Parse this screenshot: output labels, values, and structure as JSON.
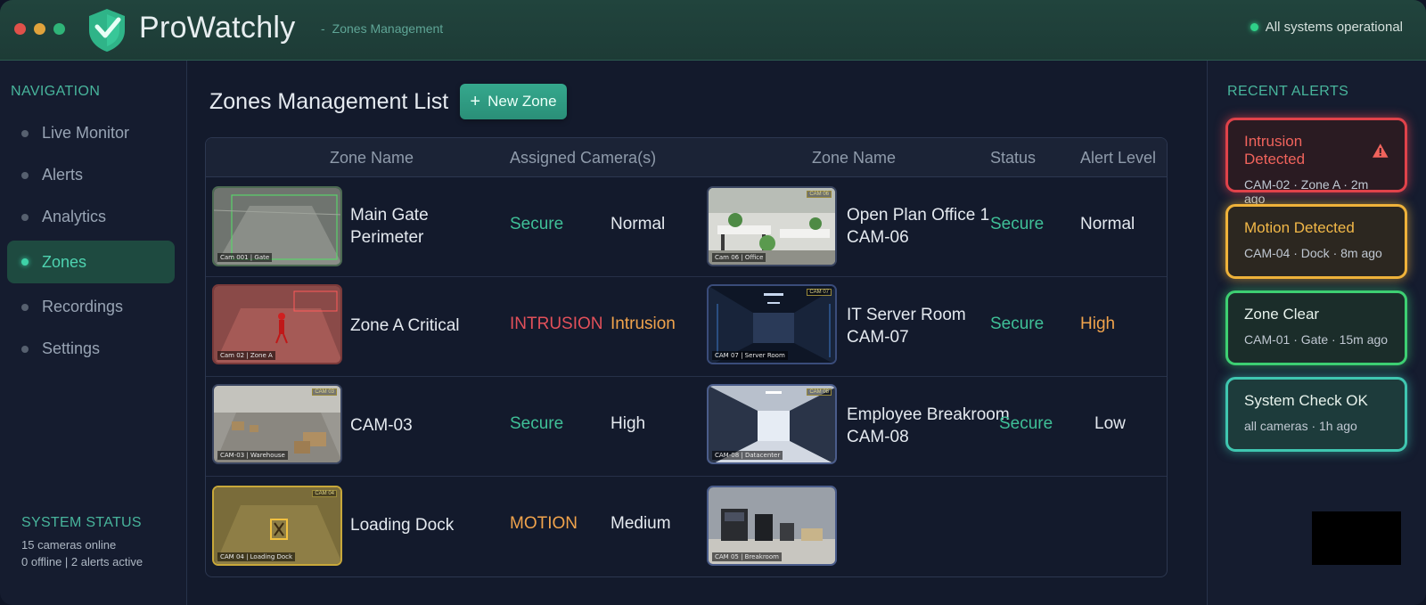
{
  "window": {
    "app_name": "ProWatchly",
    "breadcrumb_sep": "-",
    "breadcrumb": "Zones Management",
    "system_status_text": "All systems operational",
    "colors": {
      "accent": "#3fbf97",
      "danger": "#e2505a",
      "warning": "#f0a34c",
      "titlebar": "#1d3b36"
    }
  },
  "sidebar": {
    "title": "NAVIGATION",
    "items": [
      {
        "label": "Live Monitor",
        "icon": "bullet-icon",
        "active": false
      },
      {
        "label": "Alerts",
        "icon": "bullet-icon",
        "active": false
      },
      {
        "label": "Analytics",
        "icon": "bullet-icon",
        "active": false
      },
      {
        "label": "Zones",
        "icon": "bullet-icon",
        "active": true
      },
      {
        "label": "Recordings",
        "icon": "bullet-icon",
        "active": false
      },
      {
        "label": "Settings",
        "icon": "bullet-icon",
        "active": false
      }
    ],
    "system_status": {
      "title": "SYSTEM STATUS",
      "line1": "15 cameras online",
      "line2": "0 offline | 2 alerts active"
    }
  },
  "main": {
    "title": "Zones Management List",
    "new_zone_button": {
      "icon": "plus-icon",
      "label": "New Zone"
    },
    "columns": [
      "Zone Name",
      "Assigned Camera(s)",
      "Zone Name",
      "Status",
      "Alert Level"
    ],
    "rows": [
      {
        "left": {
          "thumb_caption": "Cam 001 | Gate",
          "name": "Main Gate Perimeter",
          "status": "Secure",
          "level": "Normal"
        },
        "right": {
          "thumb_caption": "Cam 06 | Office",
          "thumb_tag": "CAM 06",
          "name_line1": "Open Plan Office 1",
          "name_line2": "CAM-06",
          "status": "Secure",
          "level": "Normal"
        }
      },
      {
        "left": {
          "thumb_caption": "Cam 02 | Zone A",
          "name": "Zone A Critical",
          "status": "INTRUSION",
          "level": "Intrusion"
        },
        "right": {
          "thumb_caption": "CAM 07 | Server Room",
          "thumb_tag": "CAM 07",
          "name_line1": "IT Server Room",
          "name_line2": "CAM-07",
          "status": "Secure",
          "level": "High"
        }
      },
      {
        "left": {
          "thumb_caption": "CAM-03 | Warehouse",
          "thumb_tag": "CAM 03",
          "name": "CAM-03",
          "status": "Secure",
          "level": "High"
        },
        "right": {
          "thumb_caption": "CAM-08 | Datacenter",
          "thumb_tag": "CAM 08",
          "name_line1": "Employee Breakroom",
          "name_line2": "CAM-08",
          "status": "Secure",
          "level": "Low"
        }
      },
      {
        "left": {
          "thumb_caption": "CAM 04 | Loading Dock",
          "thumb_tag": "CAM 04",
          "name": "Loading Dock",
          "status": "MOTION",
          "level": "Medium"
        },
        "right": {
          "thumb_caption": "CAM 05 | Breakroom",
          "name_line1": "",
          "name_line2": "",
          "status": "",
          "level": ""
        }
      }
    ]
  },
  "alerts": {
    "title": "RECENT ALERTS",
    "items": [
      {
        "title": "Intrusion Detected",
        "icon": "warning-icon",
        "sub": "CAM-02 · Zone A · 2m ago",
        "color": "#e0424a"
      },
      {
        "title": "Motion Detected",
        "sub": "CAM-04 · Dock · 8m ago",
        "color": "#efb23a"
      },
      {
        "title": "Zone Clear",
        "sub": "CAM-01 · Gate · 15m ago",
        "color": "#3dcf72"
      },
      {
        "title": "System Check OK",
        "sub": "all cameras · 1h ago",
        "color": "#3fc6b0"
      }
    ]
  }
}
